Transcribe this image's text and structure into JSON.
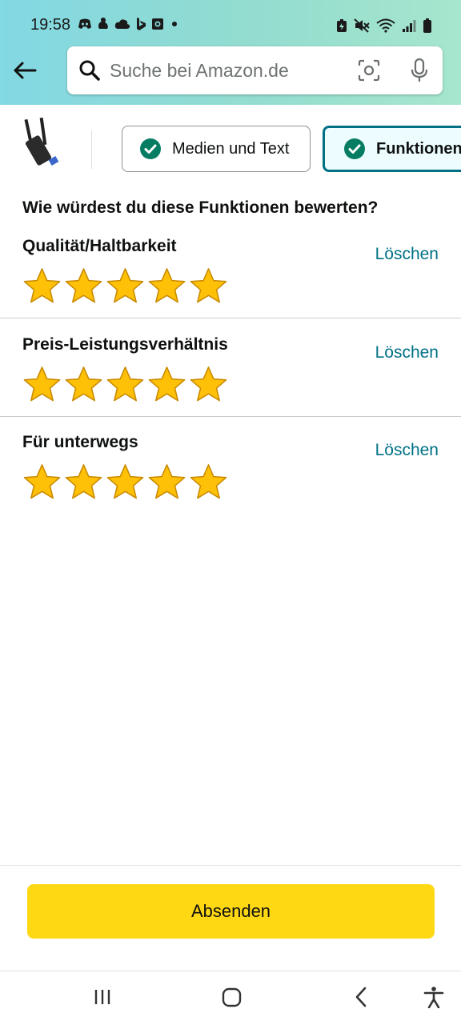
{
  "status_bar": {
    "time": "19:58",
    "notification_icons": [
      "discord-icon",
      "app-icon",
      "cloud-icon",
      "bing-icon",
      "photo-icon",
      "dot-icon"
    ],
    "system_icons": [
      "battery-saver-icon",
      "mute-icon",
      "wifi-icon",
      "signal-icon",
      "battery-icon"
    ]
  },
  "header": {
    "search_placeholder": "Suche bei Amazon.de"
  },
  "steps": [
    {
      "label": "Medien und Text",
      "completed": true,
      "active": false
    },
    {
      "label": "Funktionen",
      "completed": true,
      "active": true
    }
  ],
  "question": "Wie würdest du diese Funktionen bewerten?",
  "ratings": [
    {
      "label": "Qualität/Haltbarkeit",
      "clear_label": "Löschen",
      "stars": 5,
      "max": 5
    },
    {
      "label": "Preis-Leistungsverhältnis",
      "clear_label": "Löschen",
      "stars": 5,
      "max": 5
    },
    {
      "label": "Für unterwegs",
      "clear_label": "Löschen",
      "stars": 5,
      "max": 5
    }
  ],
  "submit_label": "Absenden",
  "colors": {
    "accent_teal": "#007185",
    "submit_yellow": "#FFD814",
    "star_gold": "#FFC107",
    "check_green": "#067D62"
  }
}
